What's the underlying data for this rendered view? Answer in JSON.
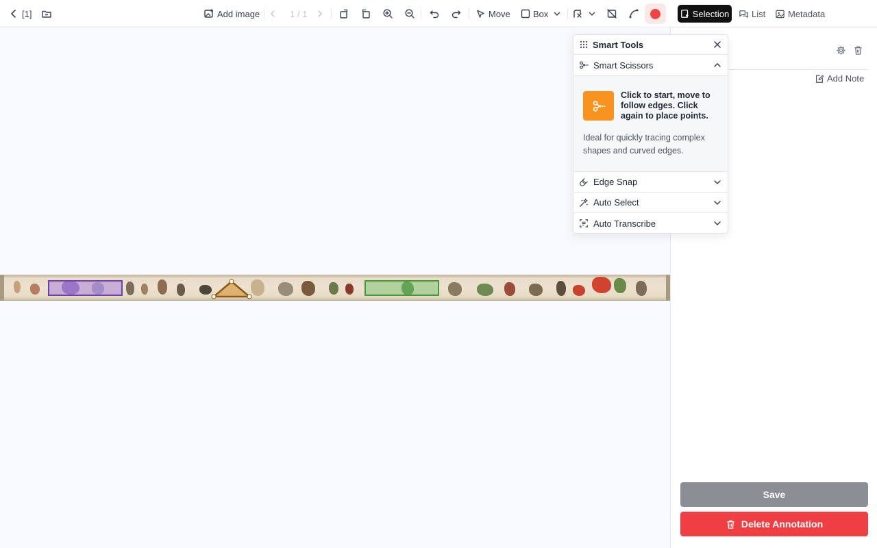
{
  "toolbar": {
    "back_label": "[1]",
    "add_image_label": "Add image",
    "page_indicator": "1 / 1",
    "move_label": "Move",
    "box_label": "Box",
    "active_color": "#ef4444",
    "selection_label": "Selection",
    "list_label": "List",
    "metadata_label": "Metadata"
  },
  "smart_tools": {
    "title": "Smart Tools",
    "sections": [
      {
        "label": "Smart Scissors",
        "expanded": true
      },
      {
        "label": "Edge Snap",
        "expanded": false
      },
      {
        "label": "Auto Select",
        "expanded": false
      },
      {
        "label": "Auto Transcribe",
        "expanded": false
      }
    ],
    "tip_title": "Click to start, move to follow edges. Click again to place points.",
    "tip_description": "Ideal for quickly tracing complex shapes and curved edges."
  },
  "sidebar": {
    "add_note_label": "Add Note",
    "save_label": "Save",
    "delete_label": "Delete Annotation"
  },
  "annotations": [
    {
      "shape": "box",
      "color": "#6d3fb5"
    },
    {
      "shape": "polygon",
      "color": "#8a5a12"
    },
    {
      "shape": "box",
      "color": "#3f9a38"
    }
  ]
}
